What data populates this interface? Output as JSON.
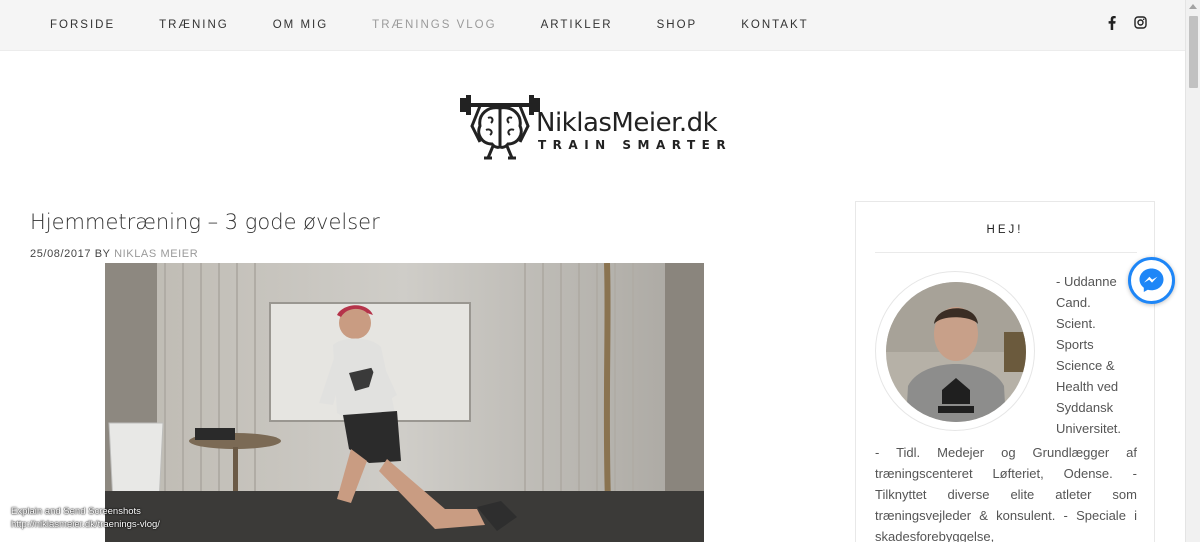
{
  "nav": {
    "items": [
      {
        "label": "FORSIDE"
      },
      {
        "label": "TRÆNING"
      },
      {
        "label": "OM MIG"
      },
      {
        "label": "TRÆNINGS VLOG"
      },
      {
        "label": "ARTIKLER"
      },
      {
        "label": "SHOP"
      },
      {
        "label": "KONTAKT"
      }
    ],
    "active_index": 3,
    "social_icons": [
      "facebook-icon",
      "instagram-icon"
    ]
  },
  "logo": {
    "brand": "NiklasMeier.dk",
    "tagline": "TRAIN SMARTER"
  },
  "post": {
    "title": "Hjemmetræning – 3 gode øvelser",
    "date": "25/08/2017",
    "by": "BY",
    "author": "NIKLAS MEIER"
  },
  "video_overlay": {
    "line1": "Explain and Send Screenshots",
    "line2": "http://niklasmeier.dk/traenings-vlog/"
  },
  "sidebar": {
    "title": "HEJ!",
    "bio_side_lines": [
      "- Uddanne",
      "Cand.",
      "Scient.",
      "Sports",
      "Science &",
      "Health ved",
      "Syddansk",
      "Universitet."
    ],
    "bio_full": "- Tidl. Medejer og Grundlægger af træningscenteret Løfteriet, Odense. - Tilknyttet diverse elite atleter som træningsvejleder & konsulent. - Speciale i skadesforebyggelse,"
  },
  "colors": {
    "nav_bg": "#f5f5f5",
    "nav_active": "#9a9a9a",
    "messenger_blue": "#1e86f7"
  }
}
